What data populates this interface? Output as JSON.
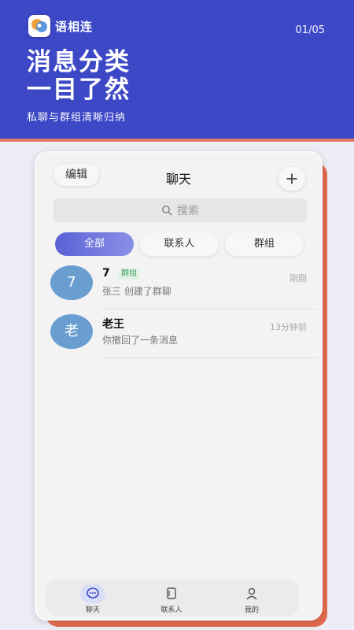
{
  "header": {
    "app_name": "语相连",
    "page_indicator": "01/05",
    "headline_line1": "消息分类",
    "headline_line2": "一目了然",
    "subline": "私聊与群组清晰归纳"
  },
  "nav": {
    "edit_label": "编辑",
    "title": "聊天"
  },
  "search": {
    "placeholder": "搜索"
  },
  "filters": [
    "全部",
    "联系人",
    "群组"
  ],
  "conversations": [
    {
      "avatar_text": "7",
      "name": "7",
      "badge": "群组",
      "time": "刚刚",
      "preview": "张三 创建了群聊"
    },
    {
      "avatar_text": "老",
      "name": "老王",
      "badge": "",
      "time": "13分钟前",
      "preview": "你撤回了一条消息"
    }
  ],
  "tabbar": {
    "chat_label": "聊天",
    "contacts_label": "联系人",
    "me_label": "我的"
  },
  "colors": {
    "hero": "#3d48c6",
    "accent_card": "#e36c4f",
    "active_filter": "#5a62d6",
    "avatar": "#6a9ed0",
    "group_badge_text": "#3f9d60"
  }
}
